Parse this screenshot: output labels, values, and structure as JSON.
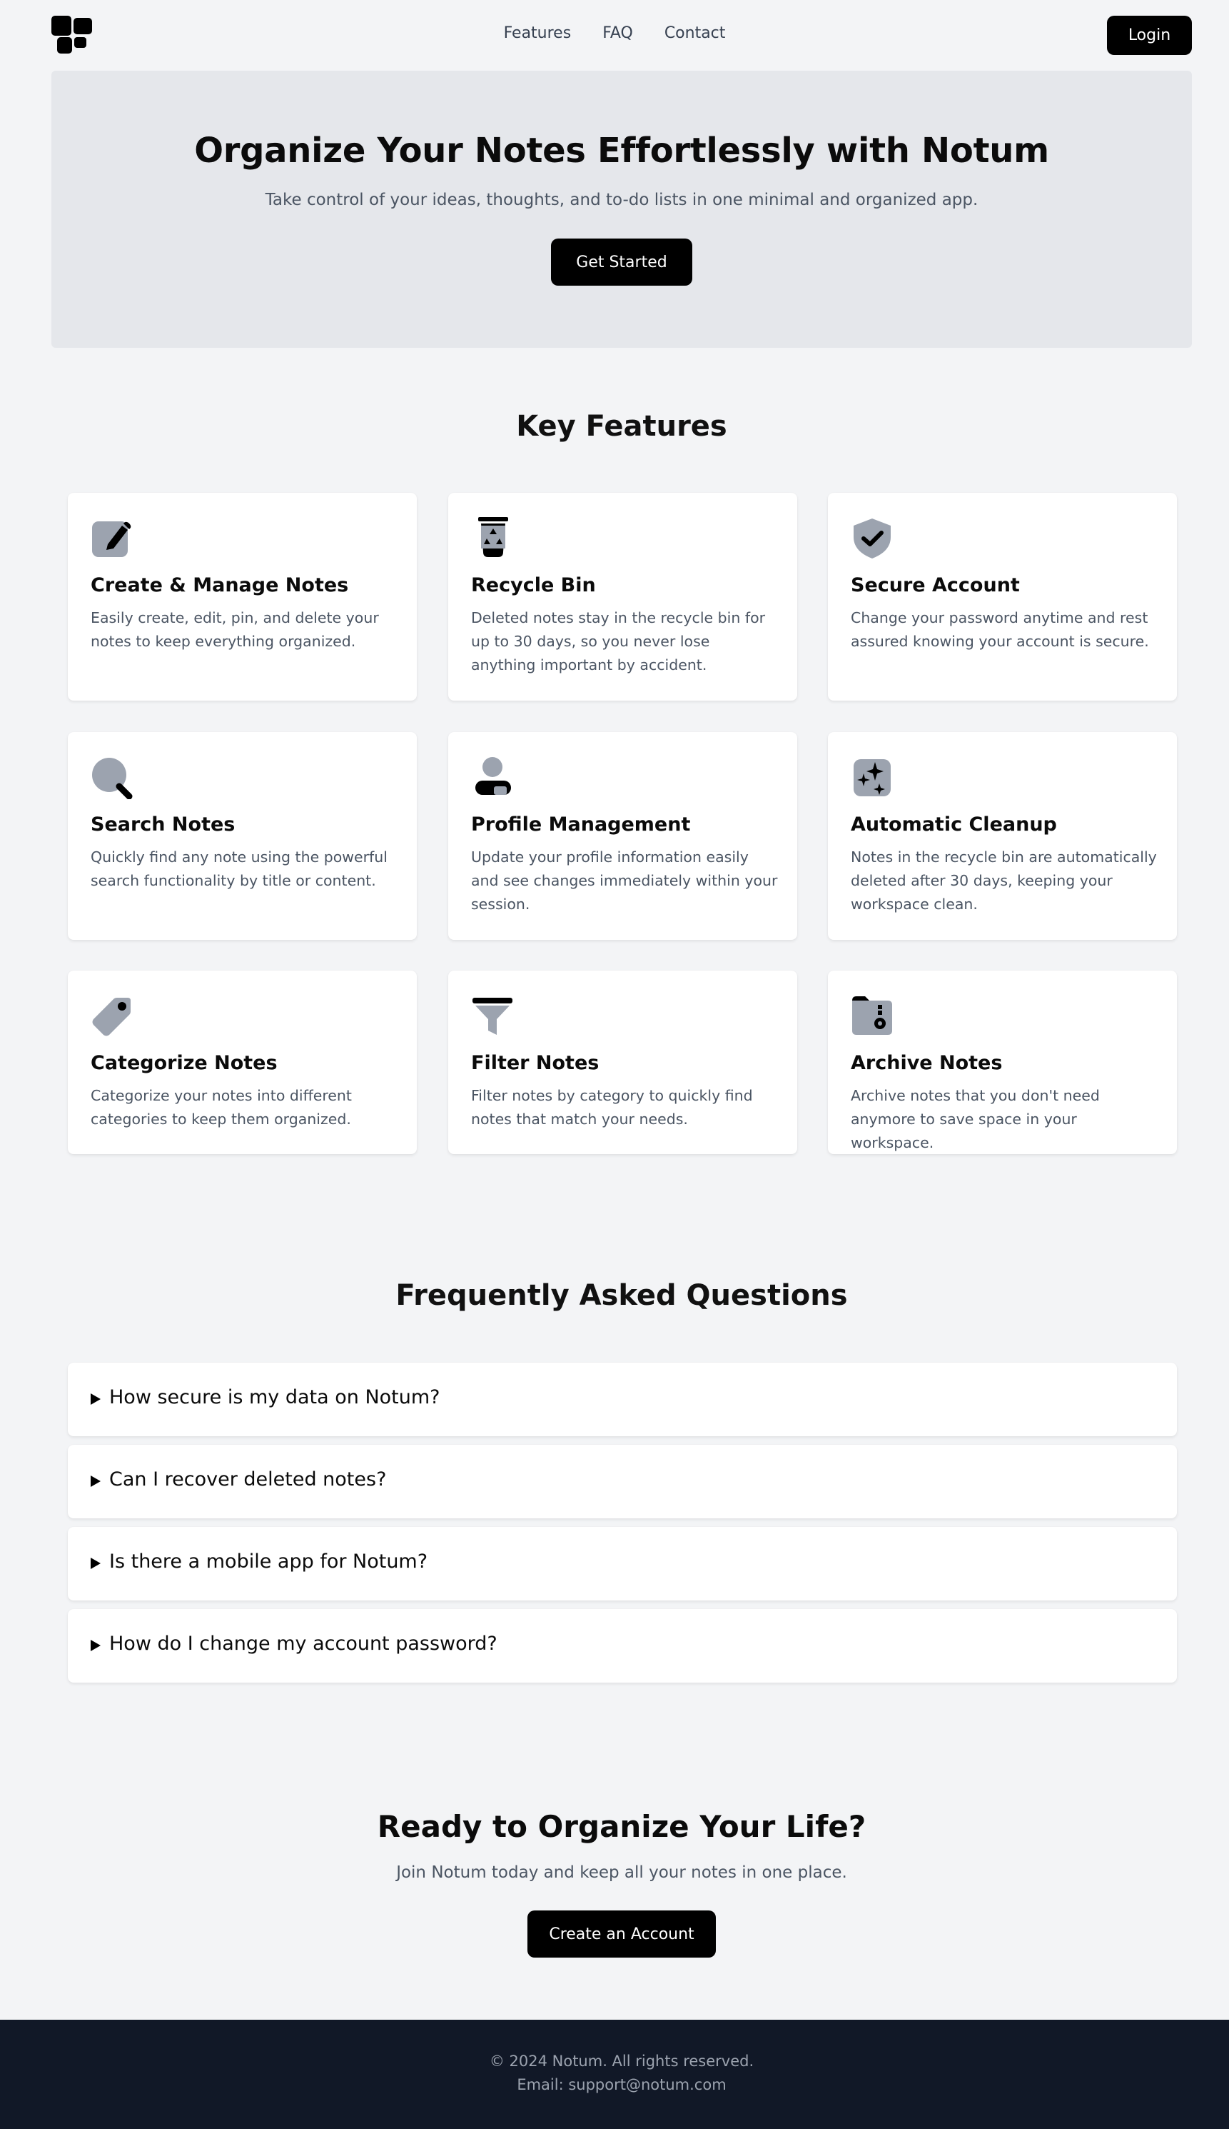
{
  "nav": {
    "links": [
      "Features",
      "FAQ",
      "Contact"
    ],
    "login_label": "Login",
    "logo_icon": "notum-logo-icon"
  },
  "hero": {
    "title": "Organize Your Notes Effortlessly with Notum",
    "subtitle": "Take control of your ideas, thoughts, and to-do lists in one minimal and organized app.",
    "cta_label": "Get Started"
  },
  "features": {
    "title": "Key Features",
    "items": [
      {
        "icon": "edit-note-icon",
        "title": "Create & Manage Notes",
        "description": "Easily create, edit, pin, and delete your notes to keep everything organized."
      },
      {
        "icon": "recycle-bin-icon",
        "title": "Recycle Bin",
        "description": "Deleted notes stay in the recycle bin for up to 30 days, so you never lose anything important by accident."
      },
      {
        "icon": "shield-check-icon",
        "title": "Secure Account",
        "description": "Change your password anytime and rest assured knowing your account is secure."
      },
      {
        "icon": "search-icon",
        "title": "Search Notes",
        "description": "Quickly find any note using the powerful search functionality by title or content."
      },
      {
        "icon": "user-profile-icon",
        "title": "Profile Management",
        "description": "Update your profile information easily and see changes immediately within your session."
      },
      {
        "icon": "sparkles-icon",
        "title": "Automatic Cleanup",
        "description": "Notes in the recycle bin are automatically deleted after 30 days, keeping your workspace clean."
      },
      {
        "icon": "tag-icon",
        "title": "Categorize Notes",
        "description": "Categorize your notes into different categories to keep them organized."
      },
      {
        "icon": "filter-icon",
        "title": "Filter Notes",
        "description": "Filter notes by category to quickly find notes that match your needs."
      },
      {
        "icon": "archive-folder-icon",
        "title": "Archive Notes",
        "description": "Archive notes that you don't need anymore to save space in your workspace."
      }
    ]
  },
  "faq": {
    "title": "Frequently Asked Questions",
    "items": [
      {
        "question": "How secure is my data on Notum?"
      },
      {
        "question": "Can I recover deleted notes?"
      },
      {
        "question": "Is there a mobile app for Notum?"
      },
      {
        "question": "How do I change my account password?"
      }
    ]
  },
  "cta": {
    "title": "Ready to Organize Your Life?",
    "subtitle": "Join Notum today and keep all your notes in one place.",
    "button_label": "Create an Account"
  },
  "footer": {
    "copyright": "© 2024 Notum. All rights reserved.",
    "email": "Email: support@notum.com"
  },
  "colors": {
    "background": "#f3f4f6",
    "hero_background": "#e5e7eb",
    "button": "#000000",
    "icon_gray": "#9ca3af",
    "footer_background": "#111827"
  }
}
